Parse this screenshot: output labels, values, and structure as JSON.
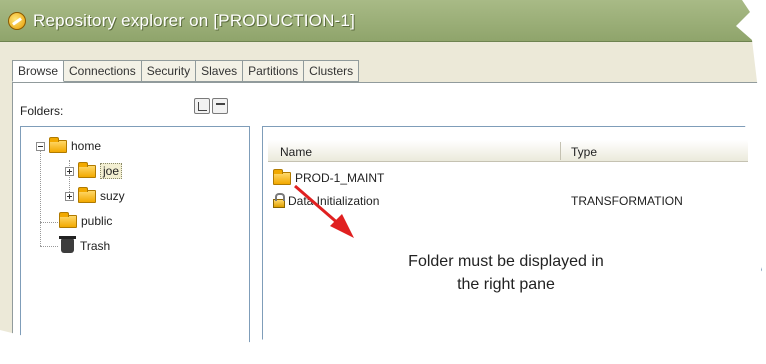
{
  "window": {
    "title": "Repository explorer on [PRODUCTION-1]"
  },
  "tabs": [
    {
      "label": "Browse",
      "selected": true
    },
    {
      "label": "Connections"
    },
    {
      "label": "Security"
    },
    {
      "label": "Slaves"
    },
    {
      "label": "Partitions"
    },
    {
      "label": "Clusters"
    }
  ],
  "folders_panel": {
    "label": "Folders:",
    "tree": [
      {
        "label": "home"
      },
      {
        "label": "joe"
      },
      {
        "label": "suzy"
      },
      {
        "label": "public"
      },
      {
        "label": "Trash"
      }
    ]
  },
  "content_list": {
    "columns": {
      "name": "Name",
      "type": "Type"
    },
    "rows": [
      {
        "name": "PROD-1_MAINT",
        "type": "",
        "icon": "folder-icon"
      },
      {
        "name": "Data Initialization",
        "type": "TRANSFORMATION",
        "icon": "lock-icon"
      }
    ]
  },
  "annotation": {
    "text_line1": "Folder must be displayed in",
    "text_line2": "the right pane",
    "arrow_color": "#e02020"
  }
}
